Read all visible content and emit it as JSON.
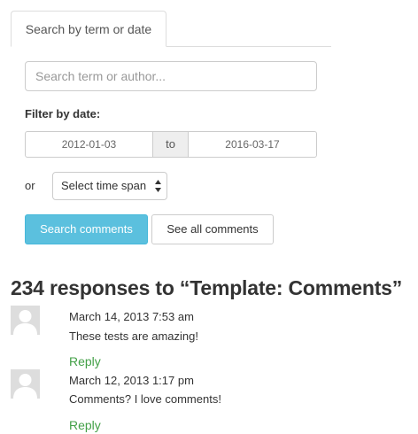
{
  "tabs": [
    {
      "label": "Search by term or date",
      "active": true
    }
  ],
  "search": {
    "placeholder": "Search term or author...",
    "value": ""
  },
  "date_filter": {
    "label": "Filter by date:",
    "from": "2012-01-03",
    "separator": "to",
    "to": "2016-03-17"
  },
  "time_span": {
    "or_label": "or",
    "selected": "Select time span"
  },
  "buttons": {
    "search": "Search comments",
    "see_all": "See all comments"
  },
  "responses": {
    "title": "234 responses to “Template: Comments”"
  },
  "comments": [
    {
      "date": "March 14, 2013 7:53 am",
      "text": "These tests are amazing!",
      "reply": "Reply"
    },
    {
      "date": "March 12, 2013 1:17 pm",
      "text": "Comments? I love comments!",
      "reply": "Reply"
    }
  ],
  "colors": {
    "primary_button": "#5bc0de",
    "reply_link": "#43a047",
    "avatar_bg": "#dddddd"
  }
}
